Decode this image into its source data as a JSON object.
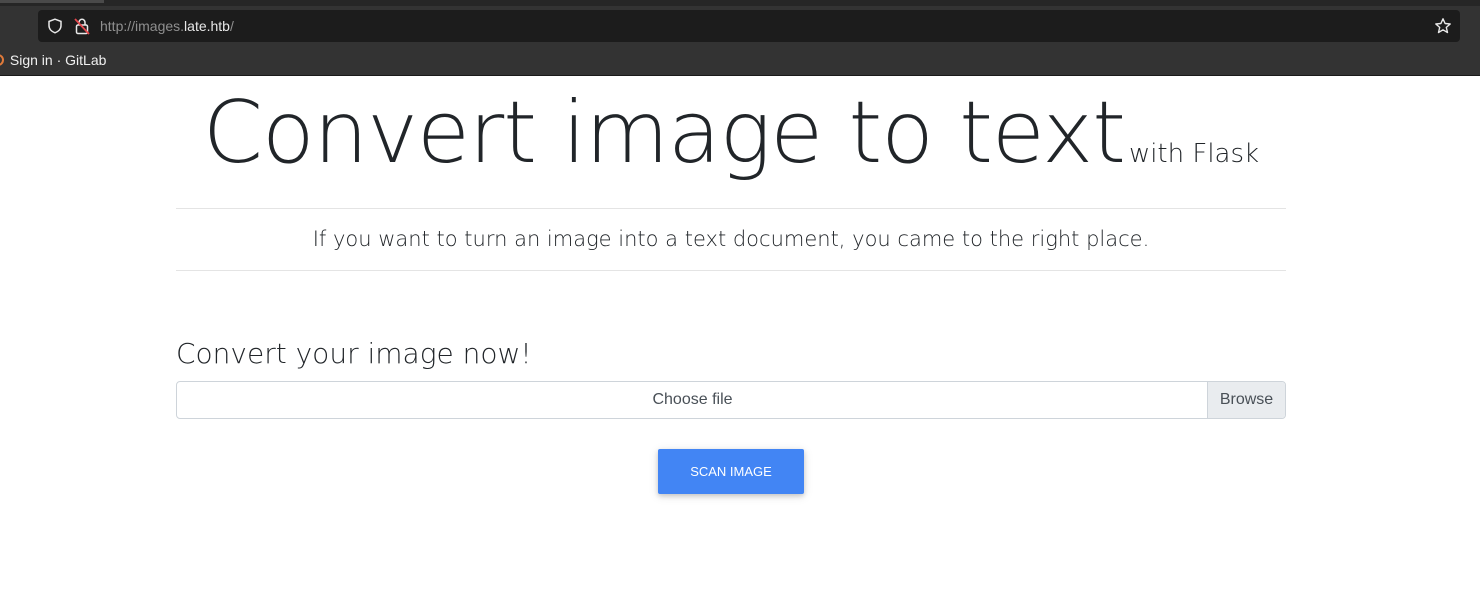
{
  "browser": {
    "url_prefix": "http://images.",
    "url_host": "late.htb",
    "url_suffix": "/",
    "bookmark_label": "Sign in · GitLab",
    "icons": [
      "shield-icon",
      "lock-icon",
      "star-icon",
      "gitlab-icon"
    ]
  },
  "page": {
    "headline": "Convert image to text",
    "headline_small": "with Flask",
    "lead": "If you want to turn an image into a text document, you came to the right place.",
    "section_title": "Convert your image now!",
    "file_input": {
      "label": "Choose file",
      "browse_label": "Browse"
    },
    "scan_button_label": "SCAN IMAGE",
    "accent_color": "#4285f4"
  }
}
